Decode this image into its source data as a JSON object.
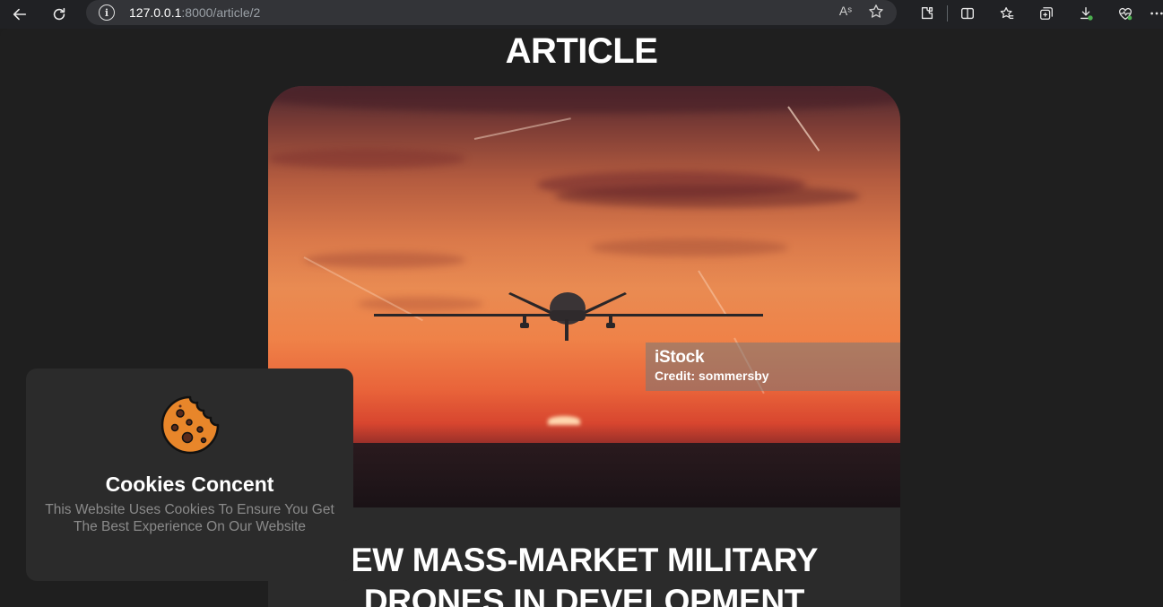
{
  "browser": {
    "url_host": "127.0.0.1",
    "url_path": ":8000/article/2",
    "icons": [
      "back-arrow-icon",
      "reload-icon",
      "site-info-icon",
      "read-aloud-icon",
      "favorite-star-icon",
      "extensions-icon",
      "split-screen-icon",
      "favorites-icon",
      "collections-icon",
      "downloads-icon",
      "browser-essentials-icon",
      "more-menu-icon"
    ]
  },
  "page": {
    "title": "ARTICLE"
  },
  "article": {
    "image_watermark_brand": "iStock",
    "image_credit": "Credit: sommersby",
    "headline_line1": "EW MASS-MARKET MILITARY",
    "headline_line2": "DRONES IN DEVELOPMENT"
  },
  "cookie_banner": {
    "title": "Cookies Concent",
    "message": "This Website Uses Cookies To Ensure You Get The Best Experience On Our Website",
    "icon": "cookie-icon"
  },
  "colors": {
    "page_bg": "#1f1f1f",
    "card_bg": "#2b2b2b",
    "cookie_orange": "#e8862a"
  }
}
